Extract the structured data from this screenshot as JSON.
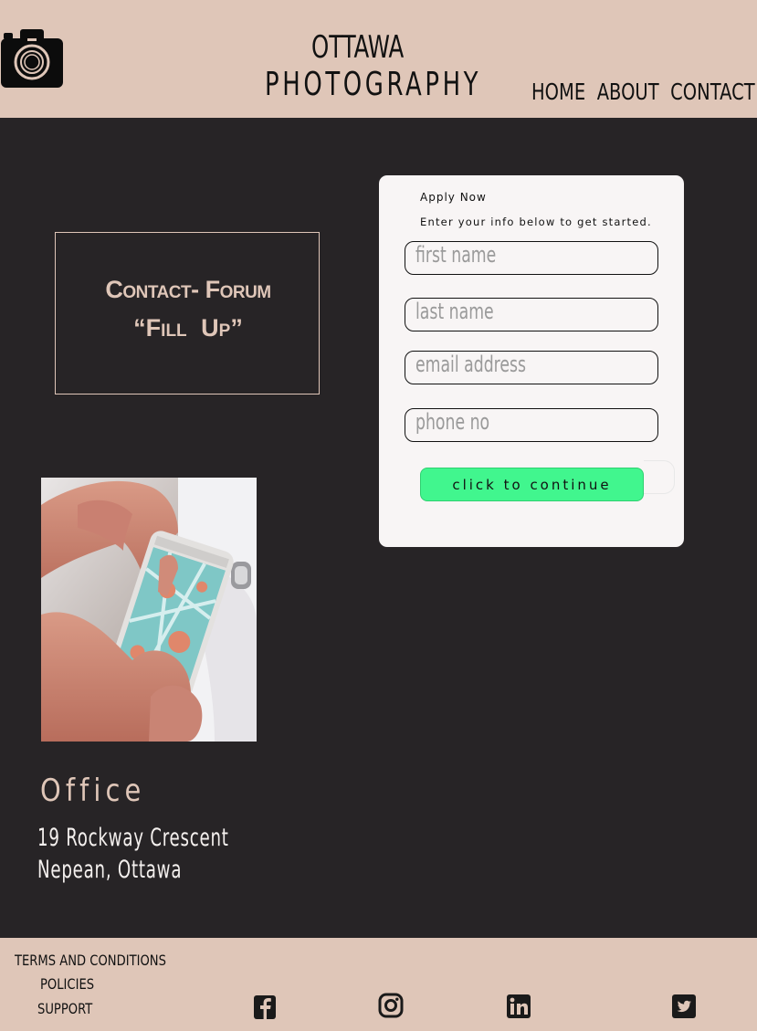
{
  "header": {
    "brand_line1": "OTTAWA",
    "brand_line2": "PHOTOGRAPHY",
    "logo_icon": "camera-icon",
    "nav": [
      {
        "label": "HOME"
      },
      {
        "label": "ABOUT"
      },
      {
        "label": "CONTACT"
      }
    ]
  },
  "forum": {
    "title": "Contact- Forum",
    "subtitle": "“Fill   Up”"
  },
  "form": {
    "title": "Apply Now",
    "subtitle": "Enter your info below to get started.",
    "fields": [
      {
        "placeholder": "first name",
        "value": ""
      },
      {
        "placeholder": "last name",
        "value": ""
      },
      {
        "placeholder": "email address",
        "value": ""
      },
      {
        "placeholder": "phone no",
        "value": ""
      }
    ],
    "submit_label": "click to continue"
  },
  "photo": {
    "subject": "hands holding a smartphone showing a map"
  },
  "office": {
    "title": "Office",
    "address_line1": "19 Rockway Crescent",
    "address_line2": "Nepean, Ottawa"
  },
  "footer": {
    "links": [
      {
        "label": "TERMS AND CONDITIONS"
      },
      {
        "label": "POLICIES"
      },
      {
        "label": "SUPPORT"
      }
    ],
    "social": [
      {
        "icon": "facebook-icon"
      },
      {
        "icon": "instagram-icon"
      },
      {
        "icon": "linkedin-icon"
      },
      {
        "icon": "twitter-icon"
      }
    ]
  },
  "colors": {
    "background": "#272426",
    "beige": "#dfc6b8",
    "button": "#41f68e",
    "card": "#f8f5f5"
  }
}
